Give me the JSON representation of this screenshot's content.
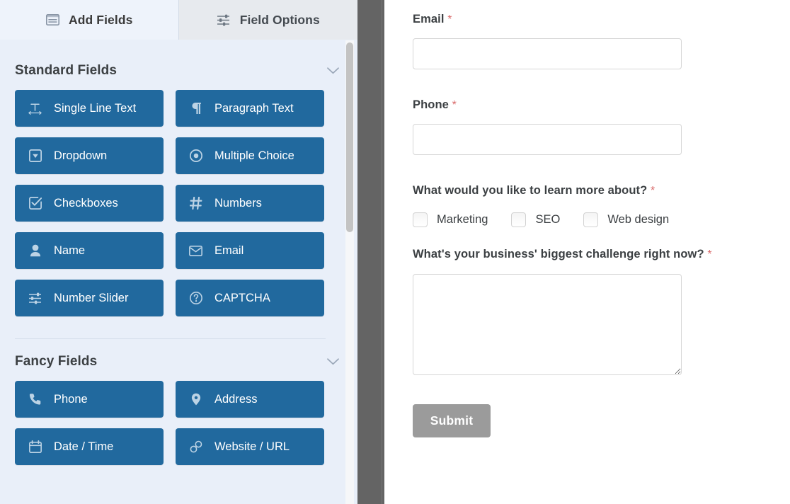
{
  "tabs": [
    {
      "label": "Add Fields",
      "icon": "list-panel-icon",
      "active": true
    },
    {
      "label": "Field Options",
      "icon": "sliders-icon",
      "active": false
    }
  ],
  "sidebar": {
    "sections": [
      {
        "title": "Standard Fields",
        "collapse_icon": "chevron-down-icon",
        "fields": [
          {
            "label": "Single Line Text",
            "icon": "text-width-icon",
            "glyph": "T"
          },
          {
            "label": "Paragraph Text",
            "icon": "paragraph-icon",
            "glyph": "¶"
          },
          {
            "label": "Dropdown",
            "icon": "caret-square-down-icon",
            "glyph": "▾"
          },
          {
            "label": "Multiple Choice",
            "icon": "radio-dot-icon",
            "glyph": "◉"
          },
          {
            "label": "Checkboxes",
            "icon": "check-square-icon",
            "glyph": "☑"
          },
          {
            "label": "Numbers",
            "icon": "hashtag-icon",
            "glyph": "#"
          },
          {
            "label": "Name",
            "icon": "user-icon",
            "glyph": "👤"
          },
          {
            "label": "Email",
            "icon": "envelope-icon",
            "glyph": "✉"
          },
          {
            "label": "Number Slider",
            "icon": "sliders-icon",
            "glyph": "☲"
          },
          {
            "label": "CAPTCHA",
            "icon": "question-circle-icon",
            "glyph": "?"
          }
        ]
      },
      {
        "title": "Fancy Fields",
        "collapse_icon": "chevron-down-icon",
        "fields": [
          {
            "label": "Phone",
            "icon": "phone-icon",
            "glyph": "☎"
          },
          {
            "label": "Address",
            "icon": "map-marker-icon",
            "glyph": "📍"
          },
          {
            "label": "Date / Time",
            "icon": "calendar-icon",
            "glyph": "📅"
          },
          {
            "label": "Website / URL",
            "icon": "link-icon",
            "glyph": "🔗"
          }
        ]
      }
    ]
  },
  "preview": {
    "required_marker": "*",
    "fields": [
      {
        "type": "text",
        "label": "Email",
        "required": true,
        "value": "",
        "placeholder": ""
      },
      {
        "type": "text",
        "label": "Phone",
        "required": true,
        "value": "",
        "placeholder": ""
      },
      {
        "type": "checkboxes",
        "label": "What would you like to learn more about?",
        "required": true,
        "choices": [
          {
            "label": "Marketing",
            "checked": false
          },
          {
            "label": "SEO",
            "checked": false
          },
          {
            "label": "Web design",
            "checked": false
          }
        ]
      },
      {
        "type": "textarea",
        "label": "What's your business' biggest challenge right now?",
        "required": true,
        "value": "",
        "placeholder": ""
      }
    ],
    "submit_label": "Submit"
  },
  "colors": {
    "field_button_blue": "#21699e",
    "sidebar_background": "#e9eff9",
    "gutter_gray": "#646464",
    "submit_gray": "#9b9b9b",
    "required_red": "#d96a6a"
  }
}
